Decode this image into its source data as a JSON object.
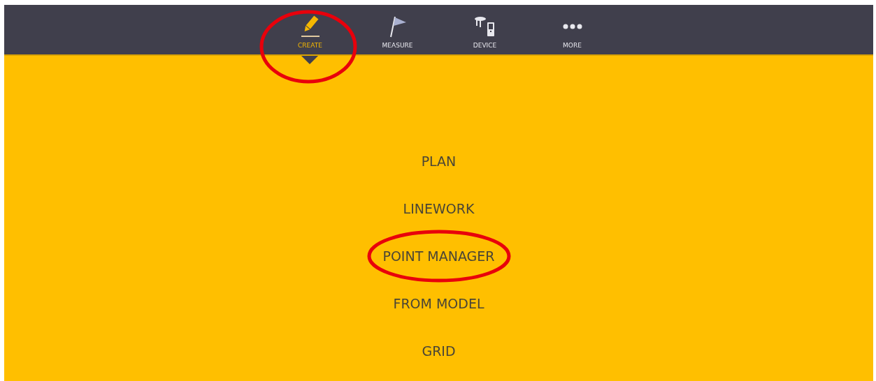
{
  "tabs": [
    {
      "label": "CREATE",
      "kind": "pencil",
      "selected": true,
      "circled": true
    },
    {
      "label": "MEASURE",
      "kind": "flag",
      "selected": false,
      "circled": false
    },
    {
      "label": "DEVICE",
      "kind": "device",
      "selected": false,
      "circled": false
    },
    {
      "label": "MORE",
      "kind": "dots",
      "selected": false,
      "circled": false
    }
  ],
  "menu": [
    {
      "label": "PLAN",
      "circled": false
    },
    {
      "label": "LINEWORK",
      "circled": false
    },
    {
      "label": "POINT MANAGER",
      "circled": true
    },
    {
      "label": "FROM MODEL",
      "circled": false
    },
    {
      "label": "GRID",
      "circled": false
    }
  ]
}
